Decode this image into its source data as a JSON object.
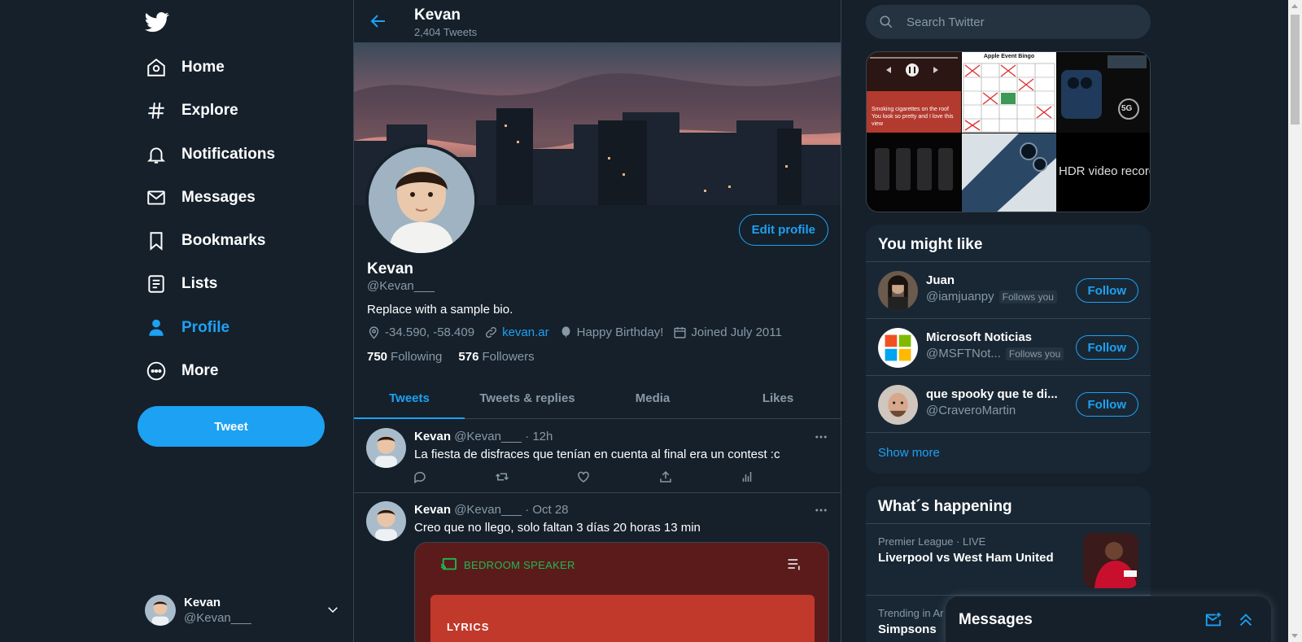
{
  "nav": {
    "logo": "twitter-bird-icon",
    "items": [
      {
        "label": "Home",
        "icon": "home-icon"
      },
      {
        "label": "Explore",
        "icon": "hashtag-icon"
      },
      {
        "label": "Notifications",
        "icon": "bell-icon"
      },
      {
        "label": "Messages",
        "icon": "envelope-icon"
      },
      {
        "label": "Bookmarks",
        "icon": "bookmark-icon"
      },
      {
        "label": "Lists",
        "icon": "list-icon"
      },
      {
        "label": "Profile",
        "icon": "person-icon",
        "active": true
      },
      {
        "label": "More",
        "icon": "more-circle-icon"
      }
    ],
    "tweet_button": "Tweet",
    "account": {
      "name": "Kevan",
      "handle": "@Kevan___"
    }
  },
  "header": {
    "name": "Kevan",
    "tweet_count": "2,404 Tweets"
  },
  "profile": {
    "name": "Kevan",
    "handle": "@Kevan___",
    "edit_button": "Edit profile",
    "bio": "Replace with a sample bio.",
    "location": "-34.590, -58.409",
    "website": "kevan.ar",
    "birthday": "Happy Birthday!",
    "joined": "Joined July 2011",
    "following_count": "750",
    "following_label": "Following",
    "followers_count": "576",
    "followers_label": "Followers"
  },
  "tabs": [
    "Tweets",
    "Tweets & replies",
    "Media",
    "Likes"
  ],
  "tweets": [
    {
      "name": "Kevan",
      "handle": "@Kevan___",
      "time": "· 12h",
      "text": "La fiesta de disfraces que tenían en cuenta al final era un contest :c"
    },
    {
      "name": "Kevan",
      "handle": "@Kevan___",
      "time": "· Oct 28",
      "text": "Creo que no llego, solo faltan 3 días 20 horas 13 min",
      "media": {
        "speaker": "BEDROOM SPEAKER",
        "lyrics": "LYRICS"
      }
    }
  ],
  "search": {
    "placeholder": "Search Twitter"
  },
  "media_grid": {
    "cells": [
      {
        "caption": "Smoking cigarettes on the roof You look so pretty and I love this view"
      },
      {
        "caption": "Apple Event Bingo"
      },
      {
        "caption": "5G"
      },
      {
        "caption": ""
      },
      {
        "caption": ""
      },
      {
        "caption": "HDR video recordin"
      }
    ]
  },
  "you_might_like": {
    "title": "You might like",
    "users": [
      {
        "name": "Juan",
        "handle": "@iamjuanpy",
        "follows_you": "Follows you",
        "button": "Follow"
      },
      {
        "name": "Microsoft Noticias",
        "handle": "@MSFTNot...",
        "follows_you": "Follows you",
        "button": "Follow"
      },
      {
        "name": "que spooky que te di...",
        "handle": "@CraveroMartin",
        "follows_you": "",
        "button": "Follow"
      }
    ],
    "show_more": "Show more"
  },
  "whats_happening": {
    "title": "What´s happening",
    "trends": [
      {
        "context": "Premier League · LIVE",
        "title": "Liverpool vs West Ham United"
      },
      {
        "context": "Trending in Ar",
        "title": "Simpsons"
      }
    ]
  },
  "messages_drawer": {
    "title": "Messages"
  },
  "colors": {
    "background": "#15202b",
    "accent": "#1da1f2",
    "muted": "#8899a6",
    "panel": "#192734",
    "border": "#38444d"
  }
}
